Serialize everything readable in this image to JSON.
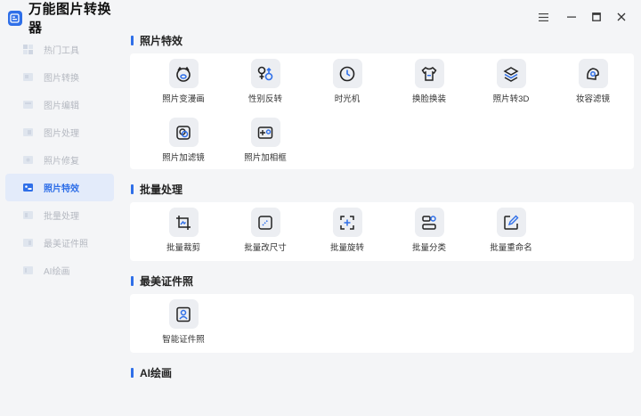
{
  "app": {
    "title": "万能图片转换器"
  },
  "sidebar": {
    "items": [
      {
        "label": "热门工具",
        "icon": "fire-icon"
      },
      {
        "label": "图片转换",
        "icon": "convert-icon"
      },
      {
        "label": "图片编辑",
        "icon": "edit-icon"
      },
      {
        "label": "图片处理",
        "icon": "process-icon"
      },
      {
        "label": "照片修复",
        "icon": "repair-icon"
      },
      {
        "label": "照片特效",
        "icon": "effects-icon"
      },
      {
        "label": "批量处理",
        "icon": "batch-icon"
      },
      {
        "label": "最美证件照",
        "icon": "id-photo-icon"
      },
      {
        "label": "AI绘画",
        "icon": "ai-paint-icon"
      }
    ],
    "active_label": "照片特效"
  },
  "sections": {
    "effects": {
      "title": "照片特效",
      "tools": [
        {
          "label": "照片变漫画",
          "icon": "cartoon-face-icon"
        },
        {
          "label": "性别反转",
          "icon": "gender-icon"
        },
        {
          "label": "时光机",
          "icon": "time-machine-icon"
        },
        {
          "label": "换脸换装",
          "icon": "shirt-icon"
        },
        {
          "label": "照片转3D",
          "icon": "layers-3d-icon"
        },
        {
          "label": "妆容滤镜",
          "icon": "makeup-icon"
        },
        {
          "label": "照片加滤镜",
          "icon": "filter-icon"
        },
        {
          "label": "照片加相框",
          "icon": "frame-icon"
        }
      ]
    },
    "batch": {
      "title": "批量处理",
      "tools": [
        {
          "label": "批量裁剪",
          "icon": "crop-icon"
        },
        {
          "label": "批量改尺寸",
          "icon": "resize-icon"
        },
        {
          "label": "批量旋转",
          "icon": "rotate-icon"
        },
        {
          "label": "批量分类",
          "icon": "classify-icon"
        },
        {
          "label": "批量重命名",
          "icon": "rename-icon"
        }
      ]
    },
    "id_photo": {
      "title": "最美证件照",
      "tools": [
        {
          "label": "智能证件照",
          "icon": "id-card-icon"
        }
      ]
    },
    "ai_paint": {
      "title": "AI绘画"
    }
  },
  "colors": {
    "accent": "#2f6fe8",
    "sidebar_active_bg": "#e3ebfa",
    "nav_inactive": "#b4b8c0"
  }
}
